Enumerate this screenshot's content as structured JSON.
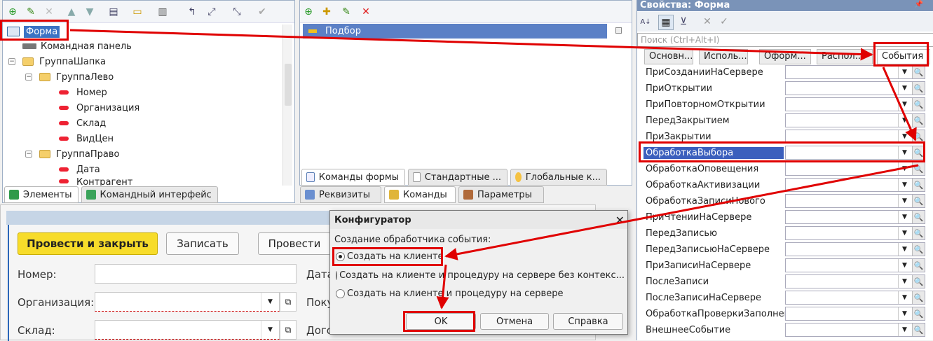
{
  "tree": {
    "toolbar_icons": [
      "add-icon",
      "edit-icon",
      "delete-icon",
      "move-up-icon",
      "move-down-icon",
      "form-icon",
      "layout-icon",
      "group-icon",
      "undo-icon",
      "check-icon"
    ],
    "root": "Форма",
    "items": [
      "Командная панель",
      "ГруппаШапка",
      "ГруппаЛево",
      "Номер",
      "Организация",
      "Склад",
      "ВидЦен",
      "ГруппаПраво",
      "Дата",
      "Контрагент"
    ],
    "bottom_tabs": [
      "Элементы",
      "Командный интерфейс"
    ]
  },
  "commands": {
    "selected": "Подбор",
    "tabs": [
      "Команды формы",
      "Стандартные ...",
      "Глобальные к..."
    ],
    "bottom_tabs": [
      "Реквизиты",
      "Команды",
      "Параметры"
    ]
  },
  "props": {
    "title": "Свойства: Форма",
    "search_placeholder": "Поиск (Ctrl+Alt+I)",
    "tabs": [
      "Основн...",
      "Исполь...",
      "Оформ...",
      "Распол...",
      "События"
    ],
    "events": [
      "ПриСозданииНаСервере",
      "ПриОткрытии",
      "ПриПовторномОткрытии",
      "ПередЗакрытием",
      "ПриЗакрытии",
      "ОбработкаВыбора",
      "ОбработкаОповещения",
      "ОбработкаАктивизации",
      "ОбработкаЗаписиНового",
      "ПриЧтенииНаСервере",
      "ПередЗаписью",
      "ПередЗаписьюНаСервере",
      "ПриЗаписиНаСервере",
      "ПослеЗаписи",
      "ПослеЗаписиНаСервере",
      "ОбработкаПроверкиЗаполнен",
      "ВнешнееСобытие"
    ],
    "selected_index": 5
  },
  "form": {
    "btn_post_close": "Провести и закрыть",
    "btn_save": "Записать",
    "btn_post": "Провести",
    "lbl_number": "Номер:",
    "lbl_org": "Организация:",
    "lbl_warehouse": "Склад:",
    "lbl_date": "Дата",
    "lbl_buyer": "Поку",
    "lbl_contract": "Дого"
  },
  "dialog": {
    "title": "Конфигуратор",
    "prompt": "Создание обработчика события:",
    "options": [
      "Создать на клиенте",
      "Создать на клиенте и процедуру на сервере без контекс...",
      "Создать на клиенте и процедуру на сервере"
    ],
    "ok": "OK",
    "cancel": "Отмена",
    "help": "Справка"
  }
}
